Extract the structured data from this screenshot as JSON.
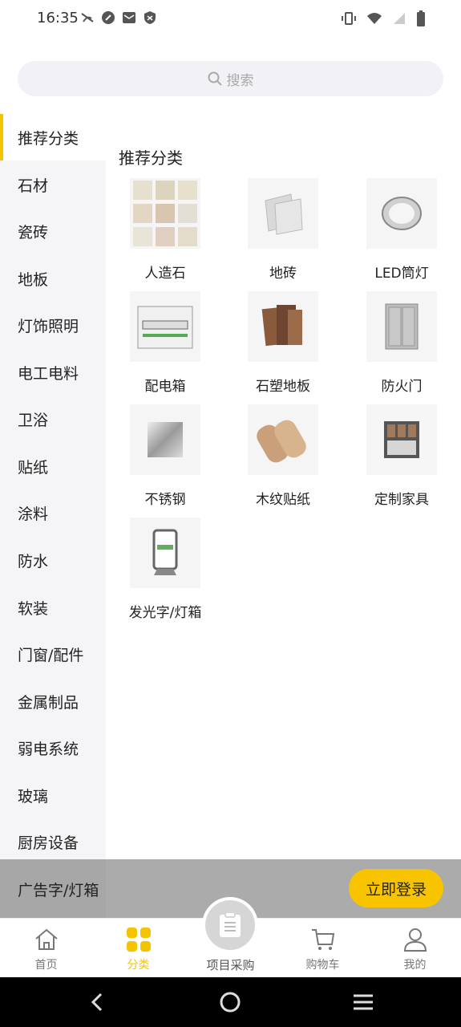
{
  "status_bar": {
    "time": "16:35",
    "left_icons": [
      "signal-off-icon",
      "compass-icon",
      "mail-icon",
      "shield-icon"
    ],
    "right_icons": [
      "vibrate-icon",
      "wifi-icon",
      "cell-signal-icon",
      "battery-icon"
    ]
  },
  "search": {
    "placeholder": "搜索",
    "icon": "search-icon"
  },
  "sidebar": {
    "items": [
      {
        "label": "推荐分类",
        "active": true
      },
      {
        "label": "石材"
      },
      {
        "label": "瓷砖"
      },
      {
        "label": "地板"
      },
      {
        "label": "灯饰照明"
      },
      {
        "label": "电工电料"
      },
      {
        "label": "卫浴"
      },
      {
        "label": "贴纸"
      },
      {
        "label": "涂料"
      },
      {
        "label": "防水"
      },
      {
        "label": "软装"
      },
      {
        "label": "门窗/配件"
      },
      {
        "label": "金属制品"
      },
      {
        "label": "弱电系统"
      },
      {
        "label": "玻璃"
      },
      {
        "label": "厨房设备"
      },
      {
        "label": "广告字/灯箱"
      }
    ]
  },
  "content": {
    "title": "推荐分类",
    "tiles": [
      {
        "label": "人造石",
        "icon": "artificial-stone-image"
      },
      {
        "label": "地砖",
        "icon": "floor-tile-image"
      },
      {
        "label": "LED筒灯",
        "icon": "led-downlight-image"
      },
      {
        "label": "配电箱",
        "icon": "distribution-box-image"
      },
      {
        "label": "石塑地板",
        "icon": "spc-floor-image"
      },
      {
        "label": "防火门",
        "icon": "fire-door-image"
      },
      {
        "label": "不锈钢",
        "icon": "stainless-steel-image"
      },
      {
        "label": "木纹贴纸",
        "icon": "woodgrain-sticker-image"
      },
      {
        "label": "定制家具",
        "icon": "custom-furniture-image"
      },
      {
        "label": "发光字/灯箱",
        "icon": "lightbox-image"
      }
    ]
  },
  "login_bar": {
    "button_label": "立即登录"
  },
  "tabbar": {
    "tabs": [
      {
        "label": "首页",
        "icon": "home-icon"
      },
      {
        "label": "分类",
        "icon": "category-icon",
        "active": true
      },
      {
        "label": "项目采购",
        "icon": "clipboard-icon"
      },
      {
        "label": "购物车",
        "icon": "cart-icon"
      },
      {
        "label": "我的",
        "icon": "user-icon"
      }
    ]
  },
  "colors": {
    "accent": "#f5c400",
    "sidebar_bg": "#f5f5f8",
    "overlay": "#787878"
  },
  "nav_buttons": [
    "back-icon",
    "home-circle-icon",
    "menu-icon"
  ]
}
